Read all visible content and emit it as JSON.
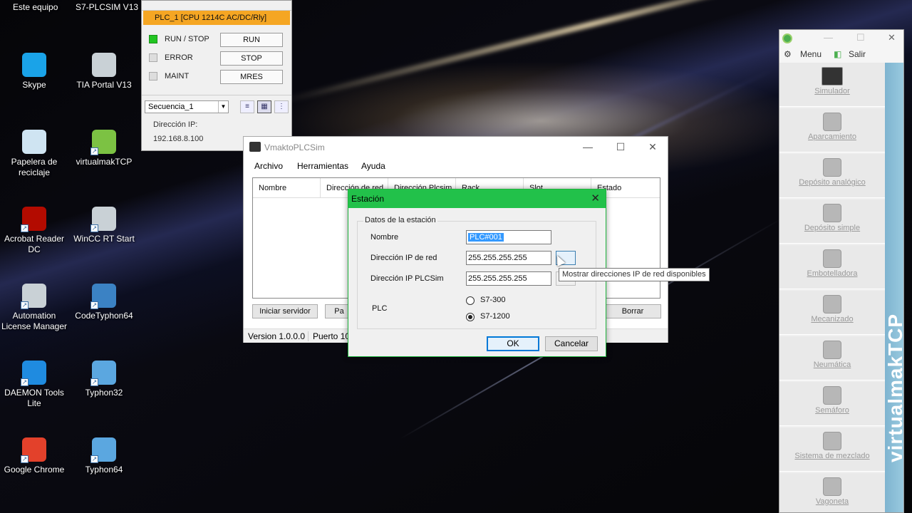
{
  "desktop": {
    "top_labels": [
      "Este equipo",
      "S7-PLCSIM V13"
    ],
    "icons": [
      {
        "label": "Skype",
        "icon": "skype-icon",
        "color": "#1aa3e8"
      },
      {
        "label": "TIA Portal V13",
        "icon": "tia-portal-icon",
        "color": "#c9d1d6"
      },
      {
        "label": "Papelera de reciclaje",
        "icon": "recycle-bin-icon",
        "color": "#cfe4f2"
      },
      {
        "label": "virtualmakTCP",
        "icon": "virtualmak-icon",
        "color": "#7cc243"
      },
      {
        "label": "Acrobat Reader DC",
        "icon": "acrobat-icon",
        "color": "#b30b00"
      },
      {
        "label": "WinCC RT Start",
        "icon": "wincc-icon",
        "color": "#c9d1d6"
      },
      {
        "label": "Automation License Manager",
        "icon": "license-manager-icon",
        "color": "#c9d1d6"
      },
      {
        "label": "CodeTyphon64",
        "icon": "codetyphon-icon",
        "color": "#3b82c4"
      },
      {
        "label": "DAEMON Tools Lite",
        "icon": "daemon-tools-icon",
        "color": "#1f8be0"
      },
      {
        "label": "Typhon32",
        "icon": "typhon32-icon",
        "color": "#5ba7e0"
      },
      {
        "label": "Google Chrome",
        "icon": "chrome-icon",
        "color": "#e3412b"
      },
      {
        "label": "Typhon64",
        "icon": "typhon64-icon",
        "color": "#5ba7e0"
      }
    ]
  },
  "plcsim": {
    "plc_name": "PLC_1 [CPU 1214C AC/DC/Rly]",
    "leds": [
      {
        "label": "RUN / STOP",
        "on": true
      },
      {
        "label": "ERROR",
        "on": false
      },
      {
        "label": "MAINT",
        "on": false
      }
    ],
    "buttons": [
      "RUN",
      "STOP",
      "MRES"
    ],
    "sequence": "Secuencia_1",
    "ip_label": "Dirección IP:",
    "ip_value": "192.168.8.100"
  },
  "vmakto": {
    "title": "VmaktoPLCSim",
    "menu": [
      "Archivo",
      "Herramientas",
      "Ayuda"
    ],
    "columns": [
      "Nombre",
      "Dirección de red",
      "Dirección Plcsim",
      "Rack",
      "Slot",
      "Estado"
    ],
    "buttons": {
      "start": "Iniciar servidor",
      "partial": "Pa",
      "delete": "Borrar"
    },
    "status": {
      "version": "Version 1.0.0.0",
      "port": "Puerto 10"
    }
  },
  "estacion": {
    "title": "Estación",
    "group_label": "Datos de la estación",
    "fields": {
      "name_label": "Nombre",
      "name_value": "PLC#001",
      "ip_red_label": "Dirección IP de red",
      "ip_red_value": "255.255.255.255",
      "ip_plcsim_label": "Dirección IP PLCSim",
      "ip_plcsim_value": "255.255.255.255"
    },
    "plc_label": "PLC",
    "plc_options": [
      {
        "label": "S7-300",
        "selected": false
      },
      {
        "label": "S7-1200",
        "selected": true
      }
    ],
    "ok": "OK",
    "cancel": "Cancelar",
    "tooltip": "Mostrar direcciones IP de red disponibles"
  },
  "virtualmak": {
    "menu": "Menu",
    "exit": "Salir",
    "brand": "virtualmakTCP",
    "items": [
      {
        "label": "Simulador",
        "icon": "simulator-icon"
      },
      {
        "label": "Aparcamiento",
        "icon": "car-icon"
      },
      {
        "label": "Depósito analógico",
        "icon": "analog-tank-icon"
      },
      {
        "label": "Depósito simple",
        "icon": "tank-icon"
      },
      {
        "label": "Embotelladora",
        "icon": "bottle-icon"
      },
      {
        "label": "Mecanizado",
        "icon": "drill-icon"
      },
      {
        "label": "Neumática",
        "icon": "pneumatic-icon"
      },
      {
        "label": "Semáforo",
        "icon": "traffic-light-icon"
      },
      {
        "label": "Sistema de mezclado",
        "icon": "mixer-icon"
      },
      {
        "label": "Vagoneta",
        "icon": "wagon-icon"
      }
    ]
  }
}
